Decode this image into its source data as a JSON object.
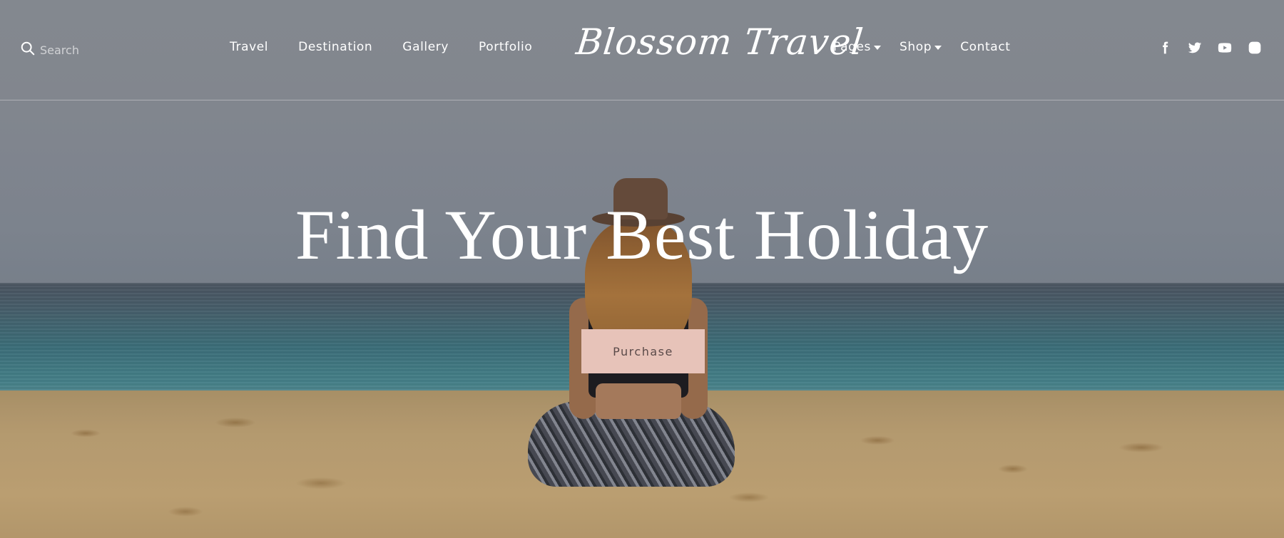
{
  "header": {
    "search": {
      "placeholder": "Search",
      "icon": "search-icon"
    },
    "nav_left": [
      {
        "label": "Travel"
      },
      {
        "label": "Destination"
      },
      {
        "label": "Gallery"
      },
      {
        "label": "Portfolio"
      }
    ],
    "logo": "Blossom Travel",
    "nav_right": [
      {
        "label": "Pages",
        "has_dropdown": true
      },
      {
        "label": "Shop",
        "has_dropdown": true
      },
      {
        "label": "Contact",
        "has_dropdown": false
      }
    ],
    "social": [
      "facebook-icon",
      "twitter-icon",
      "youtube-icon",
      "instagram-icon"
    ]
  },
  "hero": {
    "headline": "Find Your Best Holiday",
    "cta_label": "Purchase",
    "cta_color": "#e7c3b9",
    "cta_text_color": "#5a4a49"
  }
}
